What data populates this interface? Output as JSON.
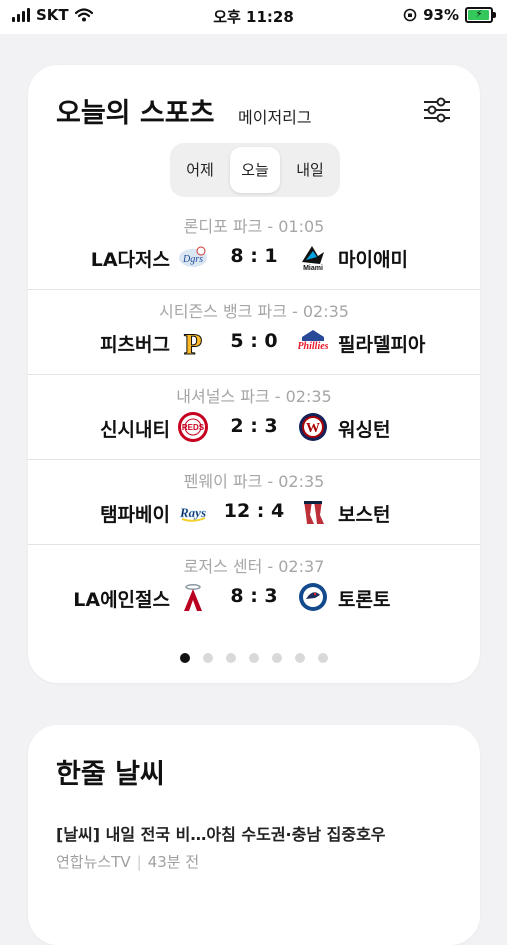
{
  "status_bar": {
    "carrier": "SKT",
    "time": "오후 11:28",
    "battery": "93%"
  },
  "sports": {
    "title": "오늘의 스포츠",
    "subtitle": "메이저리그",
    "tabs": [
      {
        "label": "어제",
        "active": false
      },
      {
        "label": "오늘",
        "active": true
      },
      {
        "label": "내일",
        "active": false
      }
    ],
    "games": [
      {
        "venue": "론디포 파크 - 01:05",
        "home": "LA다저스",
        "away": "마이애미",
        "score": "8 : 1",
        "home_logo": "dodgers-logo",
        "away_logo": "marlins-logo"
      },
      {
        "venue": "시티즌스 뱅크 파크 - 02:35",
        "home": "피츠버그",
        "away": "필라델피아",
        "score": "5 : 0",
        "home_logo": "pirates-logo",
        "away_logo": "phillies-logo"
      },
      {
        "venue": "내셔널스 파크 - 02:35",
        "home": "신시내티",
        "away": "워싱턴",
        "score": "2 : 3",
        "home_logo": "reds-logo",
        "away_logo": "nationals-logo"
      },
      {
        "venue": "펜웨이 파크 - 02:35",
        "home": "탬파베이",
        "away": "보스턴",
        "score": "12 : 4",
        "home_logo": "rays-logo",
        "away_logo": "redsox-logo"
      },
      {
        "venue": "로저스 센터 - 02:37",
        "home": "LA에인절스",
        "away": "토론토",
        "score": "8 : 3",
        "home_logo": "angels-logo",
        "away_logo": "bluejays-logo"
      }
    ],
    "pages": 7,
    "active_page": 0
  },
  "weather": {
    "title": "한줄 날씨",
    "headline": "[날씨] 내일 전국 비…아침 수도권·충남 집중호우",
    "source": "연합뉴스TV",
    "time": "43분 전"
  },
  "colors": {
    "background": "#f2f2f4",
    "card": "#ffffff",
    "battery_fill": "#34c759",
    "muted_text": "#a6a6a6"
  }
}
